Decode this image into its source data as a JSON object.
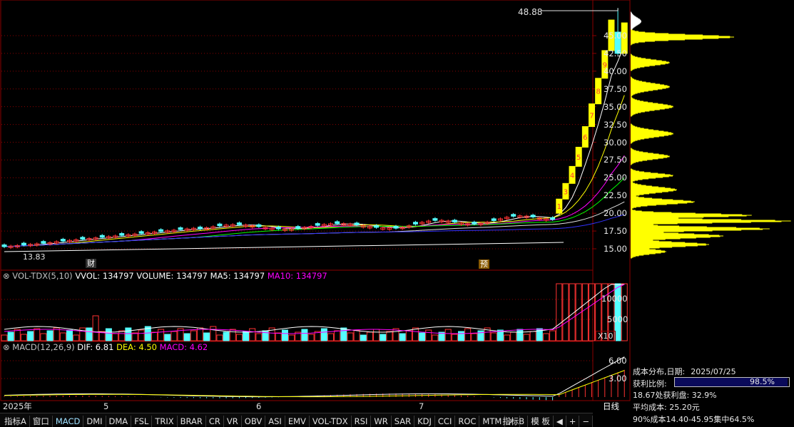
{
  "price_axis": {
    "ticks": [
      "45.00",
      "42.50",
      "40.00",
      "37.50",
      "35.00",
      "32.50",
      "30.00",
      "27.50",
      "25.00",
      "22.50",
      "20.00",
      "17.50",
      "15.00"
    ]
  },
  "price_panel": {
    "high_marker": "48.88",
    "low_marker": "13.83",
    "event_caiwu": "财",
    "event_yu": "预",
    "seq_marks": [
      "1",
      "2",
      "3",
      "4",
      "5",
      "6",
      "7",
      "8",
      "9"
    ]
  },
  "vol_panel": {
    "title": "VOL-TDX(5,10)",
    "vvol": "VVOL: 134797",
    "volume": "VOLUME: 134797",
    "ma5": "MA5: 134797",
    "ma10": "MA10: 134797",
    "ticks": [
      "10000",
      "5000"
    ],
    "multiplier": "X10"
  },
  "macd_panel": {
    "title": "MACD(12,26,9)",
    "dif": "DIF: 6.81",
    "dea": "DEA: 4.50",
    "macd": "MACD: 4.62",
    "ticks": [
      "6.00",
      "3.00"
    ]
  },
  "x_axis": {
    "labels": [
      "2025年",
      "5",
      "6",
      "7"
    ],
    "period": "日线"
  },
  "chip_panel": {
    "title": "成本分布,日期:",
    "date": "2025/07/25",
    "profit_label": "获利比例:",
    "profit_value": "98.5%",
    "profit_fraction": 0.985,
    "line1": "18.67处获利盘: 32.9%",
    "line2": "平均成本: 25.20元",
    "line3": "90%成本14.40-45.95集中64.5%"
  },
  "tabs": [
    "指标A",
    "窗口",
    "MACD",
    "DMI",
    "DMA",
    "FSL",
    "TRIX",
    "BRAR",
    "CR",
    "VR",
    "OBV",
    "ASI",
    "EMV",
    "VOL-TDX",
    "RSI",
    "WR",
    "SAR",
    "KDJ",
    "CCI",
    "ROC",
    "MTM"
  ],
  "tab_more": "〉",
  "right_tabs": [
    "指标B",
    "模 板",
    "◀",
    "+",
    "−"
  ],
  "colors": {
    "up": "#ff3232",
    "down": "#54ffff",
    "bull_yellow": "#ffff00",
    "grid": "#8b0000",
    "ma_white": "#ffffff",
    "ma_yellow": "#ffff00",
    "ma_magenta": "#ff00ff",
    "ma_green": "#00ff00",
    "ma_blue": "#3232ff"
  },
  "chart_data": {
    "type": "candlestick",
    "y_scale_note": "price range 13.83 to 48.88",
    "candles_recent": [
      {
        "label": "1",
        "open": 20.0,
        "close": 22.0,
        "high": 22.0,
        "low": 20.0
      },
      {
        "label": "3",
        "open": 22.0,
        "close": 24.2,
        "high": 24.2,
        "low": 22.0
      },
      {
        "label": "4",
        "open": 24.2,
        "close": 26.6,
        "high": 26.6,
        "low": 24.2
      },
      {
        "label": "5",
        "open": 26.6,
        "close": 29.3,
        "high": 29.3,
        "low": 26.6
      },
      {
        "label": "6",
        "open": 29.3,
        "close": 32.2,
        "high": 32.2,
        "low": 29.3
      },
      {
        "label": "7",
        "open": 32.2,
        "close": 35.4,
        "high": 35.4,
        "low": 32.2
      },
      {
        "label": "8",
        "open": 35.4,
        "close": 39.0,
        "high": 39.0,
        "low": 35.4
      },
      {
        "label": "9",
        "open": 39.0,
        "close": 42.9,
        "high": 42.9,
        "low": 39.0
      },
      {
        "open": 42.9,
        "close": 47.2,
        "high": 47.2,
        "low": 42.9
      },
      {
        "open": 45.5,
        "close": 42.5,
        "high": 48.88,
        "low": 42.3
      },
      {
        "open": 42.5,
        "close": 46.8,
        "high": 46.8,
        "low": 42.5
      }
    ]
  }
}
